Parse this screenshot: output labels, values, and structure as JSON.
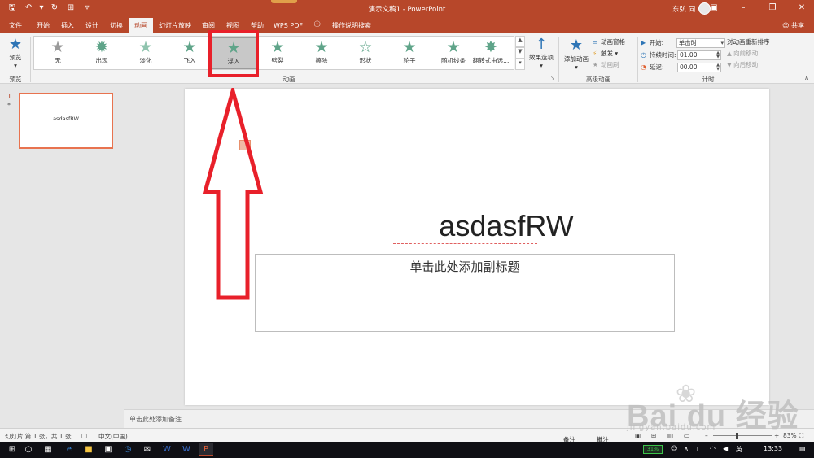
{
  "app": {
    "title": "演示文稿1 - PowerPoint",
    "user": "东弘 同",
    "window_controls": [
      "ribbon-display",
      "minimize",
      "restore",
      "close"
    ]
  },
  "quick_access": {
    "icons": [
      "save-icon",
      "undo-icon",
      "undo-dropdown-icon",
      "redo-icon",
      "start-from-beginning-icon",
      "customize-qat-icon"
    ],
    "glyphs": [
      "🖫",
      "↶",
      "▾",
      "↻",
      "⎚",
      "▿"
    ]
  },
  "tabs": [
    {
      "label": "文件"
    },
    {
      "label": "开始"
    },
    {
      "label": "插入"
    },
    {
      "label": "设计"
    },
    {
      "label": "切换"
    },
    {
      "label": "动画",
      "active": true
    },
    {
      "label": "幻灯片放映"
    },
    {
      "label": "审阅"
    },
    {
      "label": "视图"
    },
    {
      "label": "帮助"
    },
    {
      "label": "WPS PDF"
    }
  ],
  "tell_me": "操作说明搜索",
  "share": "共享",
  "ribbon": {
    "preview": {
      "label": "预览",
      "group": "预览"
    },
    "animations_group": "动画",
    "animations": [
      {
        "label": "无",
        "icon": "star-grey-icon"
      },
      {
        "label": "出现",
        "icon": "star-burst-icon"
      },
      {
        "label": "淡化",
        "icon": "star-fade-icon"
      },
      {
        "label": "飞入",
        "icon": "star-fly-icon"
      },
      {
        "label": "浮入",
        "icon": "star-float-icon",
        "selected": true
      },
      {
        "label": "劈裂",
        "icon": "star-split-icon"
      },
      {
        "label": "擦除",
        "icon": "star-wipe-icon"
      },
      {
        "label": "形状",
        "icon": "star-shape-icon"
      },
      {
        "label": "轮子",
        "icon": "star-wheel-icon"
      },
      {
        "label": "随机线条",
        "icon": "star-random-bars-icon"
      },
      {
        "label": "翻转式由远...",
        "icon": "star-grow-turn-icon"
      }
    ],
    "effect_options": "效果选项",
    "advanced": {
      "group": "高级动画",
      "add_animation": "添加动画",
      "animation_pane": "动画窗格",
      "trigger": "触发",
      "animation_painter": "动画刷"
    },
    "timing": {
      "group": "计时",
      "start_label": "开始:",
      "start_value": "单击时",
      "duration_label": "持续时间:",
      "duration_value": "01.00",
      "delay_label": "延迟:",
      "delay_value": "00.00",
      "reorder_title": "对动画重新排序",
      "move_earlier": "向前移动",
      "move_later": "向后移动"
    }
  },
  "thumbnails": [
    {
      "number": "1",
      "marker": "*",
      "text": "asdasfRW"
    }
  ],
  "slide": {
    "title": "asdasfRW",
    "subtitle_placeholder": "单击此处添加副标题"
  },
  "notes_placeholder": "单击此处添加备注",
  "status": {
    "slide_info": "幻灯片 第 1 张，共 1 张",
    "language": "中文(中国)",
    "notes": "备注",
    "comments": "批注",
    "zoom": "83%",
    "zoom_percent": 83
  },
  "watermark": {
    "brand": "Bai du 经验",
    "url": "jingyan.baidu.com"
  },
  "taskbar": {
    "apps": [
      "start-icon",
      "search-icon",
      "task-view-icon",
      "edge-icon",
      "file-explorer-icon",
      "store-icon",
      "clock-app-icon",
      "mail-icon",
      "word-icon",
      "word2-icon",
      "powerpoint-icon"
    ],
    "battery": "31%",
    "ime": "英",
    "time": "13:33"
  },
  "colors": {
    "accent": "#b7472a",
    "animation_star": "#5fa489",
    "annotation_red": "#e8202a"
  }
}
